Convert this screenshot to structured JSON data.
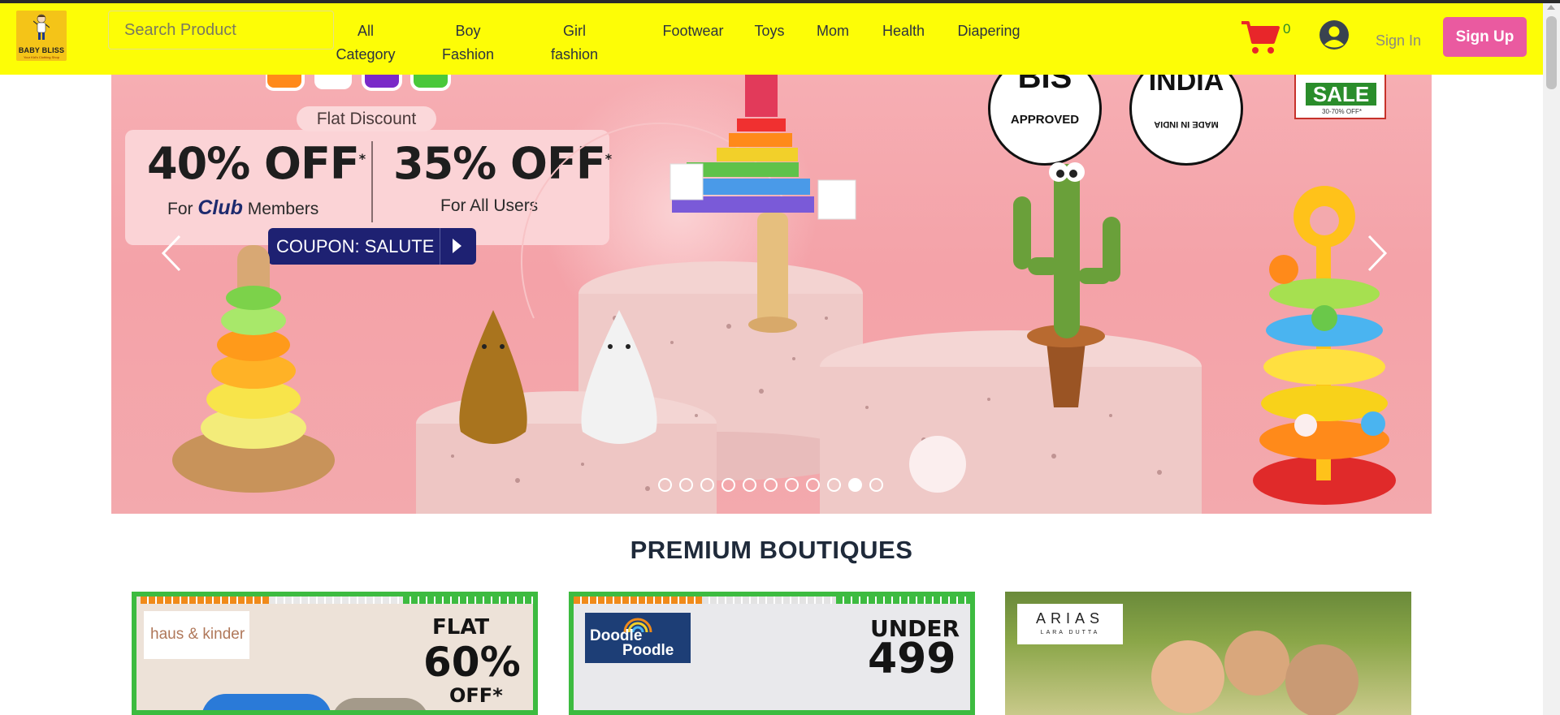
{
  "header": {
    "logo_title": "BABY BLISS",
    "logo_subtitle": "Your Kid's Clothing Shop",
    "search_placeholder": "Search Product",
    "nav": [
      {
        "line1": "All",
        "line2": "Category"
      },
      {
        "line1": "Boy",
        "line2": "Fashion"
      },
      {
        "line1": "Girl",
        "line2": "fashion"
      },
      {
        "line1": "Footwear",
        "line2": ""
      },
      {
        "line1": "Toys",
        "line2": ""
      },
      {
        "line1": "Mom",
        "line2": ""
      },
      {
        "line1": "Health",
        "line2": ""
      },
      {
        "line1": "Diapering",
        "line2": ""
      }
    ],
    "cart_count": "0",
    "signin": "Sign In",
    "signup": "Sign Up",
    "icons": {
      "cart": "cart-icon",
      "user": "user-icon"
    },
    "colors": {
      "bar": "#fdfd06",
      "signup": "#ea5aa0",
      "cart": "#e8262a"
    }
  },
  "banner": {
    "flat_discount": "Flat Discount",
    "offer1_value": "40% OFF",
    "offer1_star": "*",
    "offer1_sub_prefix": "For",
    "offer1_club": "Club",
    "offer1_sub_suffix": "Members",
    "offer2_value": "35% OFF",
    "offer2_star": "*",
    "offer2_sub": "For All Users",
    "coupon": "COUPON: SALUTE",
    "badge1_top": "BIS",
    "badge1_bottom": "APPROVED",
    "badge2_top": "INDIA",
    "badge2_bottom": "MADE IN INDIA",
    "sale": "SALE",
    "sale_sub": "30-70% OFF*",
    "slide_count": 11,
    "active_slide": 9
  },
  "boutiques": {
    "title": "PREMIUM BOUTIQUES",
    "cards": [
      {
        "brand": "haus & kinder",
        "line1": "FLAT",
        "line2": "60%",
        "line3": "OFF*"
      },
      {
        "brand_l1": "Doodle",
        "brand_l2": "Poodle",
        "line1": "UNDER",
        "line2": "499"
      },
      {
        "brand": "ARIAS",
        "brand_sub": "LARA DUTTA"
      }
    ]
  }
}
